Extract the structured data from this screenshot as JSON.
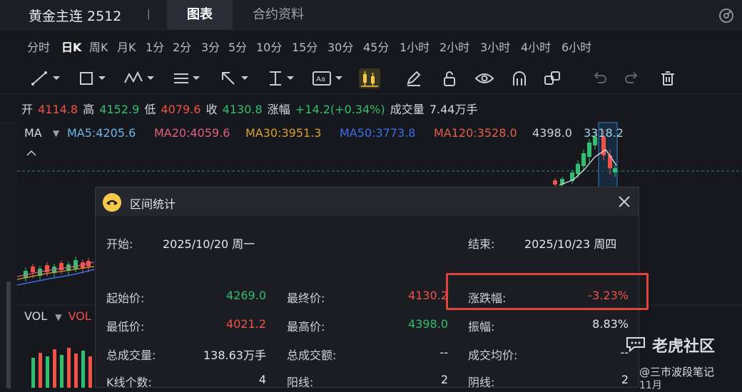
{
  "header": {
    "title": "黄金主连 2512",
    "separator": "|",
    "tabs": [
      {
        "label": "图表",
        "active": true
      },
      {
        "label": "合约资料",
        "active": false
      }
    ]
  },
  "periods": [
    "分时",
    "日K",
    "周K",
    "月K",
    "1分",
    "2分",
    "3分",
    "5分",
    "10分",
    "15分",
    "30分",
    "45分",
    "1小时",
    "2小时",
    "3小时",
    "4小时",
    "6小时"
  ],
  "active_period": "日K",
  "toolbar": [
    "line-tool-icon",
    "rectangle-tool-icon",
    "pattern-tool-icon",
    "text-tool-icon",
    "arrow-tool-icon",
    "measure-tool-icon",
    "label-tool-icon",
    "candle-range-tool-icon",
    "pencil-icon",
    "lock-icon",
    "eye-icon",
    "magnet-icon",
    "link-icon",
    "undo-icon",
    "redo-icon",
    "trash-icon"
  ],
  "quote": {
    "open_label": "开",
    "open": "4114.8",
    "high_label": "高",
    "high": "4152.9",
    "low_label": "低",
    "low": "4079.6",
    "close_label": "收",
    "close": "4130.8",
    "change_label": "涨幅",
    "change": "+14.2(+0.34%)",
    "volume_label": "成交量",
    "volume": "7.44万手"
  },
  "ma": {
    "label": "MA",
    "ma5": "MA5:4205.6",
    "ma20": "MA20:4059.6",
    "ma30": "MA30:3951.3",
    "ma50": "MA50:3773.8",
    "ma120": "MA120:3528.0",
    "overlap_text": "4398.0",
    "overlap_text2": "3318.2"
  },
  "vol": {
    "label": "VOL",
    "label2": "VOL"
  },
  "dialog": {
    "title": "区间统计",
    "start_label": "开始:",
    "start_value": "2025/10/20 周一",
    "end_label": "结束:",
    "end_value": "2025/10/23 周四",
    "stats": [
      {
        "label": "起始价:",
        "value": "4269.0"
      },
      {
        "label": "最终价:",
        "value": "4130.2"
      },
      {
        "label": "涨跌幅:",
        "value": "-3.23%"
      },
      {
        "label": "最低价:",
        "value": "4021.2"
      },
      {
        "label": "最高价:",
        "value": "4398.0"
      },
      {
        "label": "振幅:",
        "value": "8.83%"
      },
      {
        "label": "总成交量:",
        "value": "138.63万手"
      },
      {
        "label": "总成交额:",
        "value": "--"
      },
      {
        "label": "成交均价:",
        "value": "--"
      },
      {
        "label": "K线个数:",
        "value": "4"
      },
      {
        "label": "阳线:",
        "value": "2"
      },
      {
        "label": "阴线:",
        "value": "2"
      }
    ]
  },
  "watermark": {
    "brand": "老虎社区",
    "author": "@三市波段笔记",
    "partial": "11月"
  },
  "colors": {
    "up": "#f0524a",
    "down": "#2fbf71",
    "accent": "#f4c84a",
    "highlight_border": "#e2443e"
  }
}
